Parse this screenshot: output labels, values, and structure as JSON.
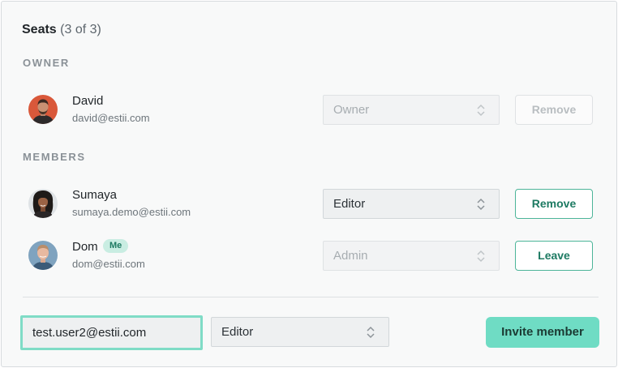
{
  "header": {
    "title": "Seats",
    "count": "(3 of 3)"
  },
  "sections": {
    "owner_label": "OWNER",
    "members_label": "MEMBERS"
  },
  "owner": {
    "name": "David",
    "email": "david@estii.com",
    "role": "Owner",
    "action": "Remove",
    "avatar": "avatar-david"
  },
  "members": [
    {
      "name": "Sumaya",
      "email": "sumaya.demo@estii.com",
      "role": "Editor",
      "action": "Remove",
      "avatar": "avatar-sumaya"
    },
    {
      "name": "Dom",
      "badge": "Me",
      "email": "dom@estii.com",
      "role": "Admin",
      "action": "Leave",
      "avatar": "avatar-dom"
    }
  ],
  "invite": {
    "email_value": "test.user2@estii.com",
    "role": "Editor",
    "button_label": "Invite member"
  },
  "colors": {
    "accent": "#6fdcc4",
    "accent_text": "#1d7a62",
    "badge_bg": "#c9ede2"
  }
}
